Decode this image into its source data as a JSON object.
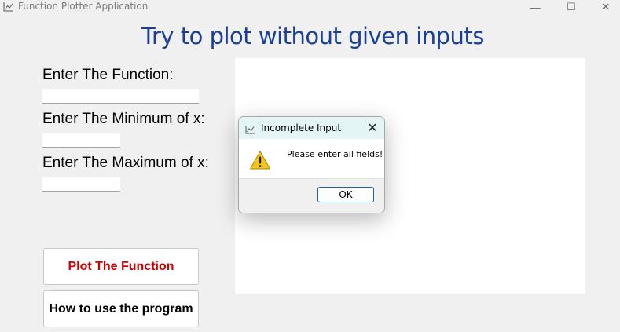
{
  "window": {
    "title": "Function Plotter Application",
    "icon": "line-chart-icon",
    "controls": {
      "minimize": "—",
      "maximize": "☐",
      "close": "✕"
    }
  },
  "headline": "Try to plot without given inputs",
  "form": {
    "function_label": "Enter The Function:",
    "function_value": "",
    "min_label": "Enter The Minimum of x:",
    "min_value": "",
    "max_label": "Enter The Maximum of x:",
    "max_value": ""
  },
  "buttons": {
    "plot": "Plot The Function",
    "help": "How to use the program"
  },
  "dialog": {
    "title": "Incomplete Input",
    "icon": "line-chart-icon",
    "close": "✕",
    "message": "Please enter all fields!",
    "warning_icon": "warning-icon",
    "ok": "OK"
  },
  "colors": {
    "headline": "#1a3f96",
    "plot_button_text": "#d40000",
    "dialog_title_bg": "#e4f5f6",
    "ok_border": "#1d5fb5",
    "warning": "#f5c518"
  }
}
